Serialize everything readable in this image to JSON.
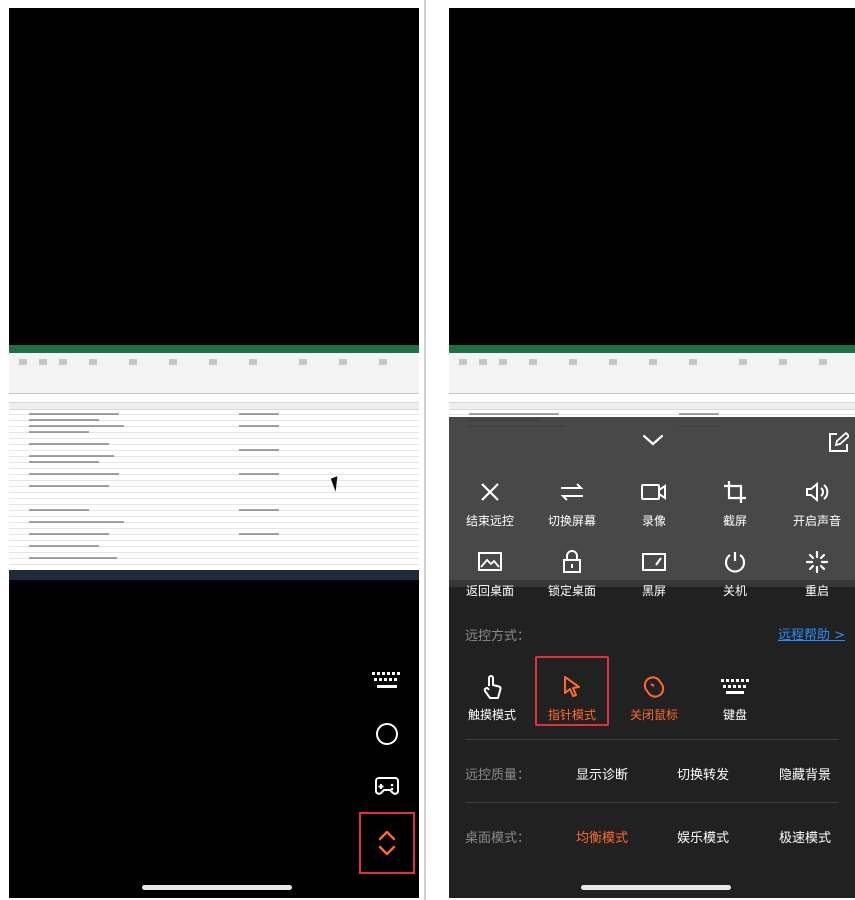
{
  "colors": {
    "accent": "#ff6a2b",
    "highlight": "#e0323c",
    "link": "#2f8cf6",
    "overlay": "#222222"
  },
  "left_phone": {
    "float_icons": [
      "keyboard-icon",
      "circle-icon",
      "gamepad-icon",
      "collapse-toggle-icon"
    ]
  },
  "panel": {
    "tools_row1": [
      {
        "icon": "close-icon",
        "label": "结束远控"
      },
      {
        "icon": "switch-icon",
        "label": "切换屏幕"
      },
      {
        "icon": "record-icon",
        "label": "录像"
      },
      {
        "icon": "crop-icon",
        "label": "截屏"
      },
      {
        "icon": "speaker-icon",
        "label": "开启声音"
      }
    ],
    "tools_row2": [
      {
        "icon": "desktop-icon",
        "label": "返回桌面"
      },
      {
        "icon": "lock-icon",
        "label": "锁定桌面"
      },
      {
        "icon": "blackscreen-icon",
        "label": "黑屏"
      },
      {
        "icon": "power-icon",
        "label": "关机"
      },
      {
        "icon": "restart-icon",
        "label": "重启"
      }
    ],
    "control_label": "远控方式：",
    "help_link": "远程帮助 >",
    "modes": [
      {
        "icon": "touch-icon",
        "label": "触摸模式",
        "state": "normal"
      },
      {
        "icon": "pointer-icon",
        "label": "指针模式",
        "state": "active"
      },
      {
        "icon": "mouse-off-icon",
        "label": "关闭鼠标",
        "state": "warn"
      },
      {
        "icon": "keyboard-icon",
        "label": "键盘",
        "state": "normal"
      }
    ],
    "quality_label": "远控质量：",
    "quality_options": [
      "显示诊断",
      "切换转发",
      "隐藏背景"
    ],
    "desktop_label": "桌面模式：",
    "desktop_options": [
      "均衡模式",
      "娱乐模式",
      "极速模式"
    ],
    "desktop_selected": "均衡模式"
  }
}
